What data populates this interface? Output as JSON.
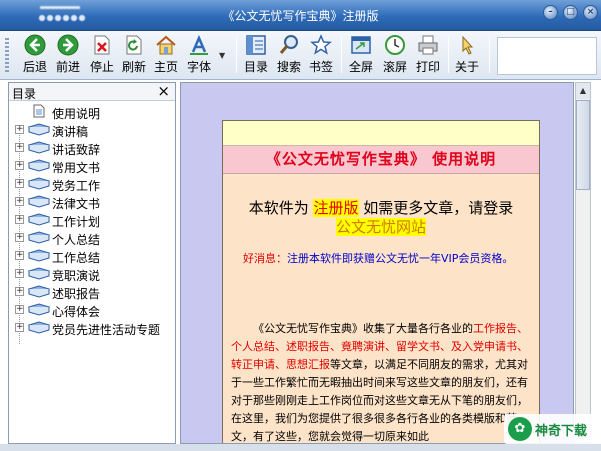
{
  "window": {
    "title": "《公文无忧写作宝典》注册版"
  },
  "toolbar": {
    "buttons": [
      {
        "label": "后退",
        "icon": "back-arrow-icon"
      },
      {
        "label": "前进",
        "icon": "forward-arrow-icon"
      },
      {
        "label": "停止",
        "icon": "stop-icon"
      },
      {
        "label": "刷新",
        "icon": "refresh-icon"
      },
      {
        "label": "主页",
        "icon": "home-icon"
      },
      {
        "label": "字体",
        "icon": "font-icon"
      },
      {
        "label": "目录",
        "icon": "toc-icon"
      },
      {
        "label": "搜索",
        "icon": "search-icon"
      },
      {
        "label": "书签",
        "icon": "bookmark-star-icon"
      },
      {
        "label": "全屏",
        "icon": "fullscreen-icon"
      },
      {
        "label": "滚屏",
        "icon": "autoscroll-clock-icon"
      },
      {
        "label": "打印",
        "icon": "printer-icon"
      },
      {
        "label": "关于",
        "icon": "about-cursor-icon"
      }
    ]
  },
  "toc": {
    "title": "目录",
    "close": "×",
    "items": [
      {
        "label": "使用说明",
        "type": "doc"
      },
      {
        "label": "演讲稿",
        "type": "book"
      },
      {
        "label": "讲话致辞",
        "type": "book"
      },
      {
        "label": "常用文书",
        "type": "book"
      },
      {
        "label": "党务工作",
        "type": "book"
      },
      {
        "label": "法律文书",
        "type": "book"
      },
      {
        "label": "工作计划",
        "type": "book"
      },
      {
        "label": "个人总结",
        "type": "book"
      },
      {
        "label": "工作总结",
        "type": "book"
      },
      {
        "label": "竞职演说",
        "type": "book"
      },
      {
        "label": "述职报告",
        "type": "book"
      },
      {
        "label": "心得体会",
        "type": "book"
      },
      {
        "label": "党员先进性活动专题",
        "type": "book"
      }
    ]
  },
  "document": {
    "title": "《公文无忧写作宝典》 使用说明",
    "notice_prefix": "本软件为",
    "notice_highlight": "注册版",
    "notice_suffix": "如需更多文章，请登录",
    "site_link": "公文无忧网站",
    "news_label": "好消息：",
    "news_text": "注册本软件即获赠公文无忧一年VIP会员资格。",
    "desc_part1": "《公文无忧写作宝典》收集了大量各行各业的",
    "desc_red1": "工作报告、个人总结、述职报告、竟聘演讲、留学文书、及入党申请书、转正申请、思想汇报",
    "desc_part2": "等文章，以满足不同朋友的需求，尤其对于一些工作繁忙而无暇抽出时间来写这些文章的朋友们，还有对于那些刚刚走上工作岗位而对这些文章无从下笔的朋友们，在这里，我们为您提供了很多很多各行各业的各类模版和范文，有了这些，您就会觉得一切原来如此"
  },
  "watermark": {
    "text": "神奇下载"
  },
  "colors": {
    "title_bar": "#2f6bb8",
    "content_bg": "#c9c8f0",
    "doc_title_band": "#f8c7cf",
    "doc_title_text": "#e0001a",
    "doc_body": "#fde3c8",
    "highlight": "#ffff00"
  }
}
